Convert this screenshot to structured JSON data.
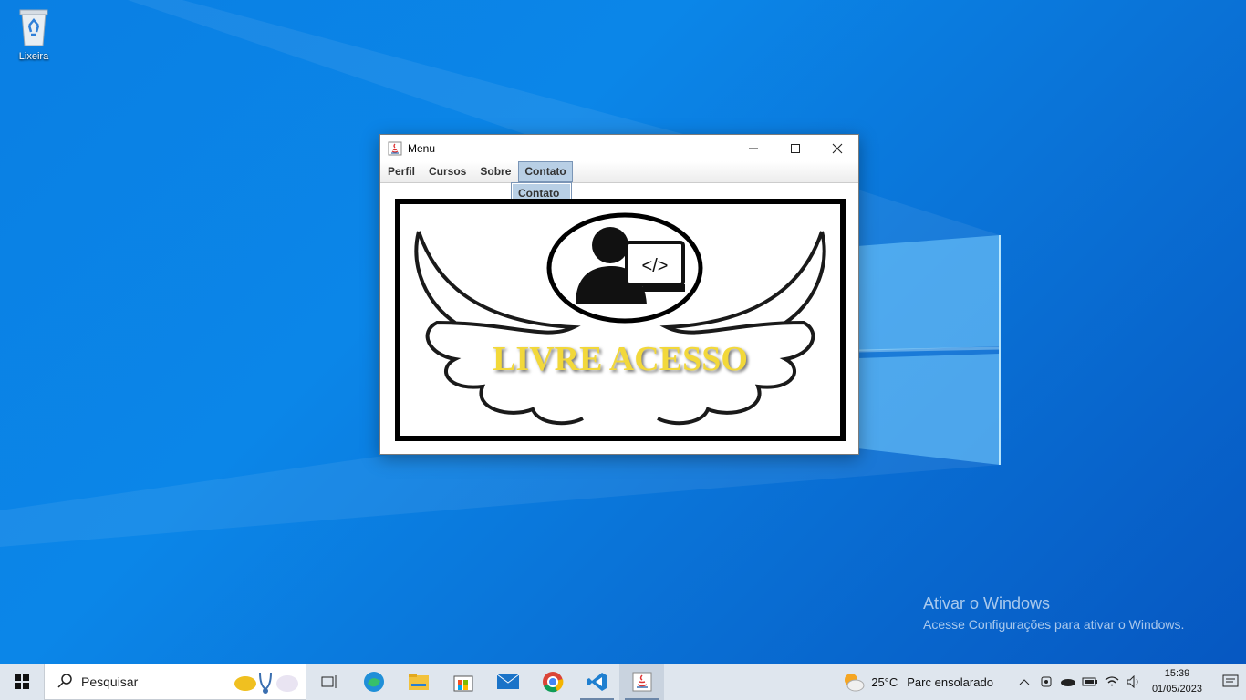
{
  "desktop": {
    "icons": [
      {
        "label": "Lixeira",
        "icon": "recycle-bin-icon"
      }
    ]
  },
  "window": {
    "title": "Menu",
    "icon": "java-icon",
    "controls": {
      "minimize": "minimize-icon",
      "maximize": "maximize-icon",
      "close": "close-icon"
    },
    "menu": [
      "Perfil",
      "Cursos",
      "Sobre",
      "Contato"
    ],
    "active_menu": "Contato",
    "dropdown_items": [
      "Contato"
    ],
    "logo_text": "LIVRE ACESSO",
    "logo_code": "</>"
  },
  "watermark": {
    "line1": "Ativar o Windows",
    "line2": "Acesse Configurações para ativar o Windows."
  },
  "taskbar": {
    "search_placeholder": "Pesquisar",
    "apps": [
      "task-view-icon",
      "edge-icon",
      "file-explorer-icon",
      "store-icon",
      "mail-icon",
      "chrome-icon",
      "vscode-icon",
      "java-icon"
    ],
    "weather": {
      "temp": "25°C",
      "desc": "Parc ensolarado"
    },
    "time": "15:39",
    "date": "01/05/2023"
  },
  "colors": {
    "accent": "#0a7fe3",
    "menu_highlight": "#b8cfe5",
    "logo_gold": "#f2d83a"
  }
}
